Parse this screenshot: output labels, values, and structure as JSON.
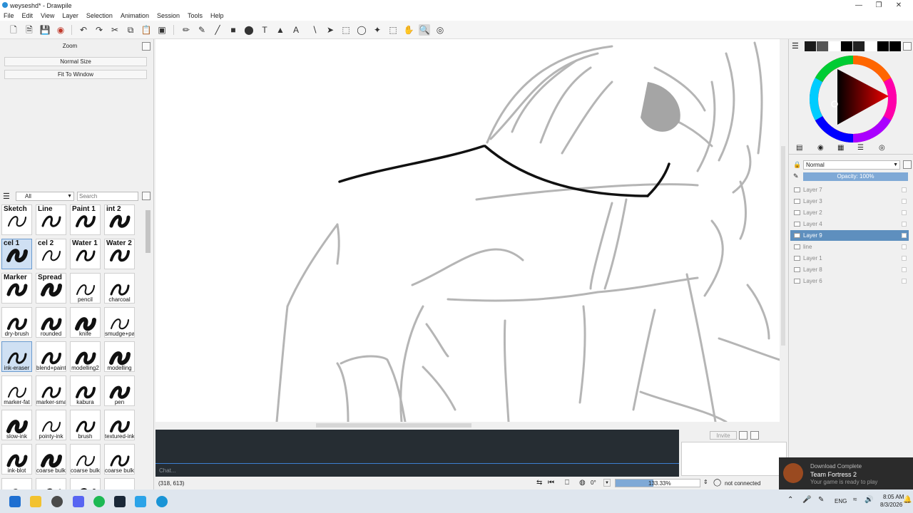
{
  "window": {
    "title": "weyseshd* - Drawpile"
  },
  "menu": [
    "File",
    "Edit",
    "View",
    "Layer",
    "Selection",
    "Animation",
    "Session",
    "Tools",
    "Help"
  ],
  "zoom_panel": {
    "title": "Zoom",
    "normal_size": "Normal Size",
    "fit_to_window": "Fit To Window"
  },
  "brush_panel": {
    "filter": "All",
    "search_placeholder": "Search"
  },
  "brushes": [
    {
      "label": "Sketch",
      "pos": "top"
    },
    {
      "label": "Line",
      "pos": "top"
    },
    {
      "label": "Paint 1",
      "pos": "top"
    },
    {
      "label": "int 2",
      "pos": "top"
    },
    {
      "label": "cel 1",
      "pos": "top"
    },
    {
      "label": "cel 2",
      "pos": "top"
    },
    {
      "label": "Water 1",
      "pos": "top"
    },
    {
      "label": "Water 2",
      "pos": "top"
    },
    {
      "label": "Marker",
      "pos": "top"
    },
    {
      "label": "Spread",
      "pos": "top"
    },
    {
      "label": "pencil",
      "pos": "bot"
    },
    {
      "label": "charcoal",
      "pos": "bot"
    },
    {
      "label": "dry-brush",
      "pos": "bot"
    },
    {
      "label": "rounded",
      "pos": "bot"
    },
    {
      "label": "knife",
      "pos": "bot"
    },
    {
      "label": "smudge+paint",
      "pos": "bot"
    },
    {
      "label": "ink-eraser",
      "pos": "bot"
    },
    {
      "label": "blend+paint",
      "pos": "bot"
    },
    {
      "label": "modelling2",
      "pos": "bot"
    },
    {
      "label": "modelling",
      "pos": "bot"
    },
    {
      "label": "marker-fat",
      "pos": "bot"
    },
    {
      "label": "marker-small",
      "pos": "bot"
    },
    {
      "label": "kabura",
      "pos": "bot"
    },
    {
      "label": "pen",
      "pos": "bot"
    },
    {
      "label": "slow-ink",
      "pos": "bot"
    },
    {
      "label": "pointy-ink",
      "pos": "bot"
    },
    {
      "label": "brush",
      "pos": "bot"
    },
    {
      "label": "textured-ink",
      "pos": "bot"
    },
    {
      "label": "ink-blot",
      "pos": "bot"
    },
    {
      "label": "coarse bulk 3",
      "pos": "bot"
    },
    {
      "label": "coarse bulk 2",
      "pos": "bot"
    },
    {
      "label": "coarse bulk 1",
      "pos": "bot"
    },
    {
      "label": "",
      "pos": "bot"
    },
    {
      "label": "",
      "pos": "bot"
    },
    {
      "label": "",
      "pos": "bot"
    },
    {
      "label": "",
      "pos": "bot"
    }
  ],
  "layers_panel": {
    "blend_mode": "Normal",
    "opacity": "Opacity: 100%"
  },
  "layers": [
    {
      "name": "Layer 7",
      "selected": false
    },
    {
      "name": "Layer 3",
      "selected": false
    },
    {
      "name": "Layer 2",
      "selected": false
    },
    {
      "name": "Layer 4",
      "selected": false
    },
    {
      "name": "Layer 9",
      "selected": true
    },
    {
      "name": "line",
      "selected": false
    },
    {
      "name": "Layer 1",
      "selected": false
    },
    {
      "name": "Layer 8",
      "selected": false
    },
    {
      "name": "Layer 6",
      "selected": false
    }
  ],
  "swatches": [
    "#1a1a1a",
    "#555555",
    "#ffffff",
    "#000000",
    "#222222",
    "#ffffff",
    "#000000",
    "#000000"
  ],
  "chat": {
    "placeholder": "Chat...",
    "invite": "Invite"
  },
  "status": {
    "coords": "(318, 613)",
    "rotation": "0°",
    "zoom": "133.33%",
    "zoom_fill": 0.45,
    "connection": "not connected"
  },
  "notification": {
    "header": "Download Complete",
    "title": "Team Fortress 2",
    "body": "Your game is ready to play"
  },
  "taskbar": {
    "time": "8:05 AM",
    "date": "8/3/2026",
    "lang": "ENG"
  },
  "colors": {
    "selection": "#5e8fbe",
    "accent": "#3d7fd1",
    "chat_bg": "#262d33"
  }
}
